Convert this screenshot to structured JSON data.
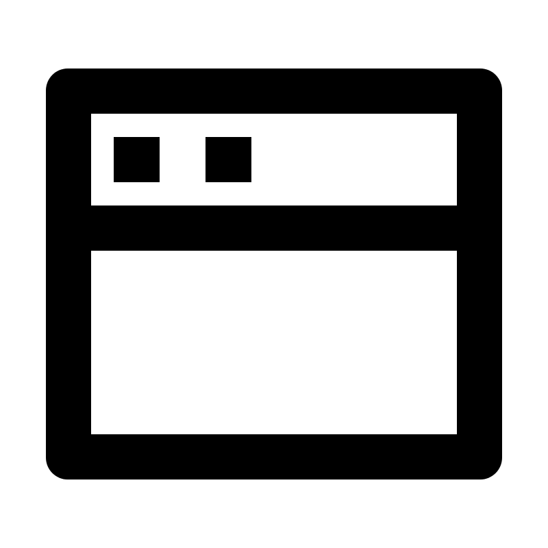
{
  "icon": {
    "name": "browser-window-icon",
    "stroke_color": "#000000",
    "background_color": "#ffffff"
  }
}
